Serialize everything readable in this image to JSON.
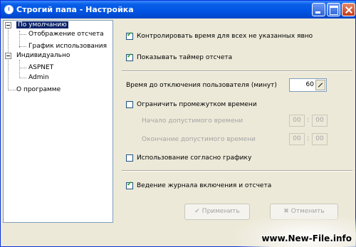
{
  "window": {
    "title": "Строгий папа - Настройка"
  },
  "tree": {
    "items": [
      {
        "label": "По умолчанию",
        "selected": true
      },
      {
        "label": "Отображение отсчета"
      },
      {
        "label": "График использования"
      },
      {
        "label": "Индивидуально"
      },
      {
        "label": "ASPNET"
      },
      {
        "label": "Admin"
      },
      {
        "label": "О программе"
      }
    ]
  },
  "settings": {
    "control_time_label": "Контролировать время для всех не указанных явно",
    "show_timer_label": "Показывать таймер отсчета",
    "disconnect_time_label": "Время до отключения пользователя (минут)",
    "disconnect_time_value": "60",
    "limit_interval_label": "Ограничить промежутком времени",
    "start_time_label": "Начало допустимого времени",
    "start_hours": "00",
    "start_minutes": "00",
    "end_time_label": "Окончание допустимого времени",
    "end_hours": "00",
    "end_minutes": "00",
    "use_schedule_label": "Использование согласно графику",
    "journal_label": "Ведение журнала включения и отсчета"
  },
  "buttons": {
    "apply": "Применить",
    "cancel": "Отменить"
  },
  "watermark": "www.New-File.info",
  "colors": {
    "titlebar": "#0054e3",
    "selection": "#0a246a",
    "window_bg": "#ece9d8",
    "check_mark": "#21a121"
  },
  "icons": [
    "app-clock-icon",
    "minimize-icon",
    "maximize-icon",
    "close-icon",
    "apply-check-icon",
    "cancel-x-icon",
    "spin-edit-icon"
  ]
}
